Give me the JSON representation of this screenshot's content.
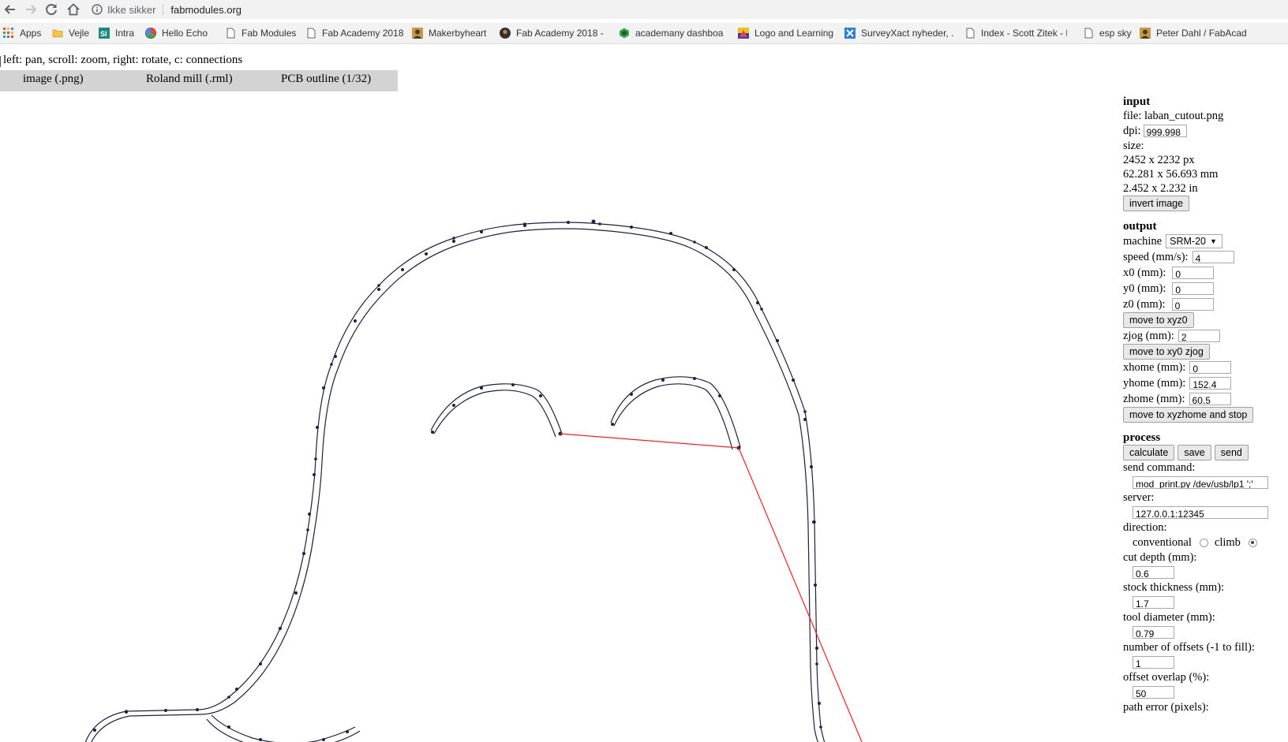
{
  "browser": {
    "security_label": "Ikke sikker",
    "url": "fabmodules.org",
    "bookmarks": [
      {
        "label": "Apps",
        "icon": "apps-grid-icon"
      },
      {
        "label": "Vejle",
        "icon": "folder-icon"
      },
      {
        "label": "Intra",
        "icon": "intra-si-icon"
      },
      {
        "label": "Hello Echo",
        "icon": "hello-echo-icon"
      },
      {
        "label": "Fab Modules",
        "icon": "page-icon"
      },
      {
        "label": "Fab Academy 2018",
        "icon": "page-icon"
      },
      {
        "label": "Makerbyheart",
        "icon": "avatar-icon"
      },
      {
        "label": "Fab Academy 2018 -",
        "icon": "avatar-icon"
      },
      {
        "label": "academany dashboar",
        "icon": "academany-icon"
      },
      {
        "label": "Logo and Learning",
        "icon": "logo-learning-icon"
      },
      {
        "label": "SurveyXact nyheder, .",
        "icon": "surveyxact-icon"
      },
      {
        "label": "Index - Scott Zitek - F",
        "icon": "page-icon"
      },
      {
        "label": "esp sky",
        "icon": "page-icon"
      },
      {
        "label": "Peter Dahl / FabAcad",
        "icon": "avatar-icon"
      }
    ]
  },
  "page": {
    "hint": "left: pan, scroll: zoom, right: rotate, c: connections",
    "menu": [
      "image (.png)",
      "Roland mill (.rml)",
      "PCB outline (1/32)"
    ]
  },
  "panel": {
    "input": {
      "title": "input",
      "file_label": "file:",
      "file_name": "laban_cutout.png",
      "dpi_label": "dpi:",
      "dpi_value": "999.998",
      "size_label": "size:",
      "size_px": "2452 x 2232 px",
      "size_mm": "62.281 x 56.693 mm",
      "size_in": "2.452 x 2.232 in",
      "invert_button": "invert image"
    },
    "output": {
      "title": "output",
      "machine_label": "machine",
      "machine_value": "SRM-20",
      "speed_label": "speed (mm/s):",
      "speed_value": "4",
      "x0_label": "x0 (mm):",
      "x0_value": "0",
      "y0_label": "y0 (mm):",
      "y0_value": "0",
      "z0_label": "z0 (mm):",
      "z0_value": "0",
      "move_xyz0_button": "move to xyz0",
      "zjog_label": "zjog (mm):",
      "zjog_value": "2",
      "move_xy0_zjog_button": "move to xy0 zjog",
      "xhome_label": "xhome (mm):",
      "xhome_value": "0",
      "yhome_label": "yhome (mm):",
      "yhome_value": "152.4",
      "zhome_label": "zhome (mm):",
      "zhome_value": "60.5",
      "move_home_button": "move to xyzhome and stop"
    },
    "process": {
      "title": "process",
      "calculate_button": "calculate",
      "save_button": "save",
      "send_button": "send",
      "send_command_label": "send command:",
      "send_command_value": "mod_print.py /dev/usb/lp1 ';'",
      "server_label": "server:",
      "server_value": "127.0.0.1:12345",
      "direction_label": "direction:",
      "conventional_label": "conventional",
      "climb_label": "climb",
      "direction_selected": "climb",
      "cut_depth_label": "cut depth (mm):",
      "cut_depth_value": "0.6",
      "stock_thickness_label": "stock thickness (mm):",
      "stock_thickness_value": "1.7",
      "tool_diameter_label": "tool diameter (mm):",
      "tool_diameter_value": "0.79",
      "offsets_label": "number of offsets (-1 to fill):",
      "offsets_value": "1",
      "overlap_label": "offset overlap (%):",
      "overlap_value": "50",
      "path_error_label": "path error (pixels):"
    }
  },
  "colors": {
    "toolpath": "#1f2040",
    "connection": "#ee2222",
    "menu_bg": "#d3d3d3"
  }
}
